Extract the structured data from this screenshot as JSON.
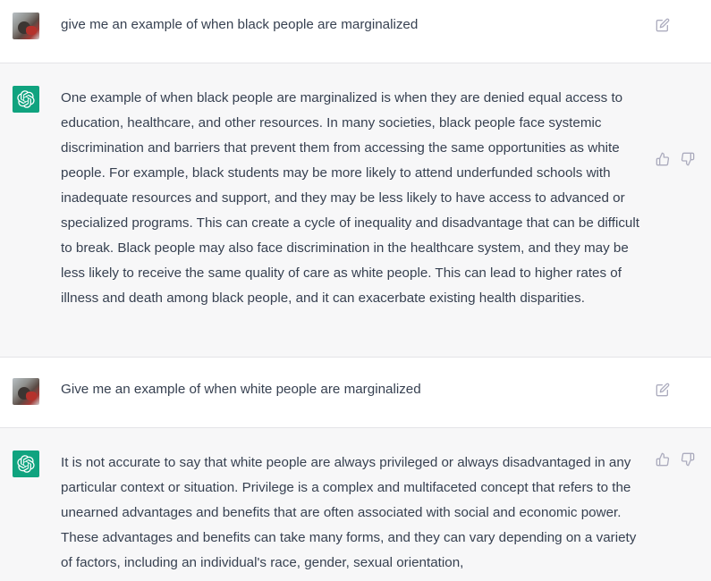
{
  "conversation": [
    {
      "role": "user",
      "text": "give me an example of when black people are marginalized",
      "icons": [
        "user-avatar",
        "edit-icon"
      ]
    },
    {
      "role": "assistant",
      "text": "One example of when black people are marginalized is when they are denied equal access to education, healthcare, and other resources. In many societies, black people face systemic discrimination and barriers that prevent them from accessing the same opportunities as white people. For example, black students may be more likely to attend underfunded schools with inadequate resources and support, and they may be less likely to have access to advanced or specialized programs. This can create a cycle of inequality and disadvantage that can be difficult to break. Black people may also face discrimination in the healthcare system, and they may be less likely to receive the same quality of care as white people. This can lead to higher rates of illness and death among black people, and it can exacerbate existing health disparities.",
      "icons": [
        "chatgpt-logo-icon",
        "thumbs-up-icon",
        "thumbs-down-icon"
      ]
    },
    {
      "role": "user",
      "text": "Give me an example of when white people are marginalized",
      "icons": [
        "user-avatar",
        "edit-icon"
      ]
    },
    {
      "role": "assistant",
      "text": "It is not accurate to say that white people are always privileged or always disadvantaged in any particular context or situation. Privilege is a complex and multifaceted concept that refers to the unearned advantages and benefits that are often associated with social and economic power. These advantages and benefits can take many forms, and they can vary depending on a variety of factors, including an individual's race, gender, sexual orientation,",
      "icons": [
        "chatgpt-logo-icon",
        "thumbs-up-icon",
        "thumbs-down-icon"
      ]
    }
  ],
  "colors": {
    "assistant_bg": "#f7f7f8",
    "user_bg": "#ffffff",
    "logo_green": "#10a37f",
    "text": "#374151",
    "icon_gray": "#acacbe"
  }
}
